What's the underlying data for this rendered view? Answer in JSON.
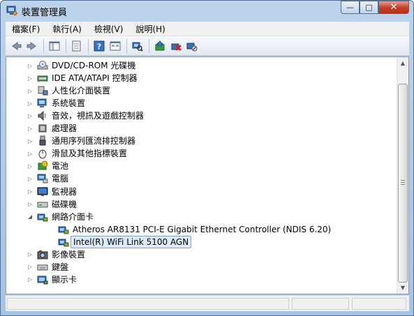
{
  "window": {
    "title": "裝置管理員"
  },
  "caption": {
    "minimize": "—",
    "maximize": "□",
    "close": "✕"
  },
  "menu": [
    {
      "label": "檔案(F)"
    },
    {
      "label": "執行(A)"
    },
    {
      "label": "檢視(V)"
    },
    {
      "label": "說明(H)"
    }
  ],
  "toolbar": [
    {
      "icon": "back-arrow-icon"
    },
    {
      "icon": "forward-arrow-icon"
    },
    {
      "sep": true
    },
    {
      "icon": "console-tree-icon"
    },
    {
      "sep": true
    },
    {
      "icon": "properties-icon"
    },
    {
      "sep": true
    },
    {
      "icon": "help-icon"
    },
    {
      "icon": "view-icon"
    },
    {
      "sep": true
    },
    {
      "icon": "scan-hardware-icon"
    },
    {
      "sep": true
    },
    {
      "icon": "update-driver-icon"
    },
    {
      "icon": "uninstall-icon"
    },
    {
      "icon": "disable-device-icon"
    }
  ],
  "tree": [
    {
      "label": "DVD/CD-ROM 光碟機",
      "level": 0,
      "expand": "collapsed",
      "icon": "dvd-drive-icon"
    },
    {
      "label": "IDE ATA/ATAPI 控制器",
      "level": 0,
      "expand": "collapsed",
      "icon": "ide-controller-icon"
    },
    {
      "label": "人性化介面裝置",
      "level": 0,
      "expand": "collapsed",
      "icon": "hid-icon"
    },
    {
      "label": "系統裝置",
      "level": 0,
      "expand": "collapsed",
      "icon": "system-device-icon"
    },
    {
      "label": "音效，視訊及遊戲控制器",
      "level": 0,
      "expand": "collapsed",
      "icon": "sound-icon"
    },
    {
      "label": "處理器",
      "level": 0,
      "expand": "collapsed",
      "icon": "processor-icon"
    },
    {
      "label": "通用序列匯流排控制器",
      "level": 0,
      "expand": "collapsed",
      "icon": "usb-icon"
    },
    {
      "label": "滑鼠及其他指標裝置",
      "level": 0,
      "expand": "collapsed",
      "icon": "mouse-icon"
    },
    {
      "label": "電池",
      "level": 0,
      "expand": "collapsed",
      "icon": "battery-icon"
    },
    {
      "label": "電腦",
      "level": 0,
      "expand": "collapsed",
      "icon": "computer-icon"
    },
    {
      "label": "監視器",
      "level": 0,
      "expand": "collapsed",
      "icon": "monitor-icon"
    },
    {
      "label": "磁碟機",
      "level": 0,
      "expand": "collapsed",
      "icon": "disk-drive-icon"
    },
    {
      "label": "網路介面卡",
      "level": 0,
      "expand": "expanded",
      "icon": "network-adapter-icon"
    },
    {
      "label": "Atheros AR8131 PCI-E Gigabit Ethernet Controller (NDIS 6.20)",
      "level": 1,
      "expand": "none",
      "icon": "network-adapter-icon"
    },
    {
      "label": "Intel(R) WiFi Link 5100 AGN",
      "level": 1,
      "expand": "none",
      "icon": "network-adapter-icon",
      "selected": true
    },
    {
      "label": "影像裝置",
      "level": 0,
      "expand": "collapsed",
      "icon": "imaging-device-icon"
    },
    {
      "label": "鍵盤",
      "level": 0,
      "expand": "collapsed",
      "icon": "keyboard-icon"
    },
    {
      "label": "顯示卡",
      "level": 0,
      "expand": "collapsed",
      "icon": "display-adapter-icon"
    }
  ]
}
